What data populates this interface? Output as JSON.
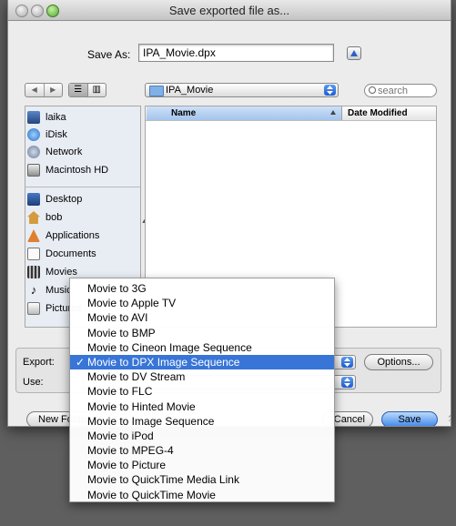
{
  "window": {
    "title": "Save exported file as..."
  },
  "save_as": {
    "label": "Save As:",
    "value": "IPA_Movie.dpx"
  },
  "toolbar": {
    "back": "◀",
    "forward": "▶",
    "view_list": "☰",
    "view_columns": "▥"
  },
  "folder": {
    "name": "IPA_Movie"
  },
  "search": {
    "placeholder": "search"
  },
  "sidebar": {
    "devices": [
      "laika",
      "iDisk",
      "Network",
      "Macintosh HD"
    ],
    "places": [
      "Desktop",
      "bob",
      "Applications",
      "Documents",
      "Movies",
      "Music",
      "Pictures"
    ]
  },
  "file_list": {
    "col_name": "Name",
    "col_date": "Date Modified"
  },
  "bottom": {
    "export_label": "Export:",
    "use_label": "Use:",
    "options_button": "Options...",
    "new_folder_button": "New Folder",
    "cancel_button": "Cancel",
    "save_button": "Save"
  },
  "menu": {
    "items": [
      "Movie to 3G",
      "Movie to Apple TV",
      "Movie to AVI",
      "Movie to BMP",
      "Movie to Cineon Image Sequence",
      "Movie to DPX Image Sequence",
      "Movie to DV Stream",
      "Movie to FLC",
      "Movie to Hinted Movie",
      "Movie to Image Sequence",
      "Movie to iPod",
      "Movie to MPEG-4",
      "Movie to Picture",
      "Movie to QuickTime Media Link",
      "Movie to QuickTime Movie"
    ],
    "checkmark": "✓"
  },
  "colors": {
    "selection": "#3875d7",
    "default_button": "#3f88ea"
  }
}
